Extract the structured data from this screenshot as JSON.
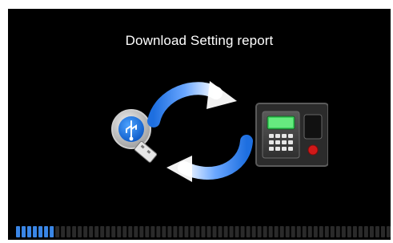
{
  "dialog": {
    "title": "Download Setting report"
  },
  "icons": {
    "source": "usb-drive-icon",
    "flow": "sync-arrows-icon",
    "target": "time-attendance-terminal-icon"
  },
  "progress": {
    "filled_segments": 7,
    "total_segments": 67,
    "fraction": 0.104
  },
  "colors": {
    "background": "#000000",
    "accent_blue": "#2f7fe0",
    "segment_filled": "#3a86e6",
    "segment_empty": "#2a2a2a",
    "text": "#ffffff"
  }
}
